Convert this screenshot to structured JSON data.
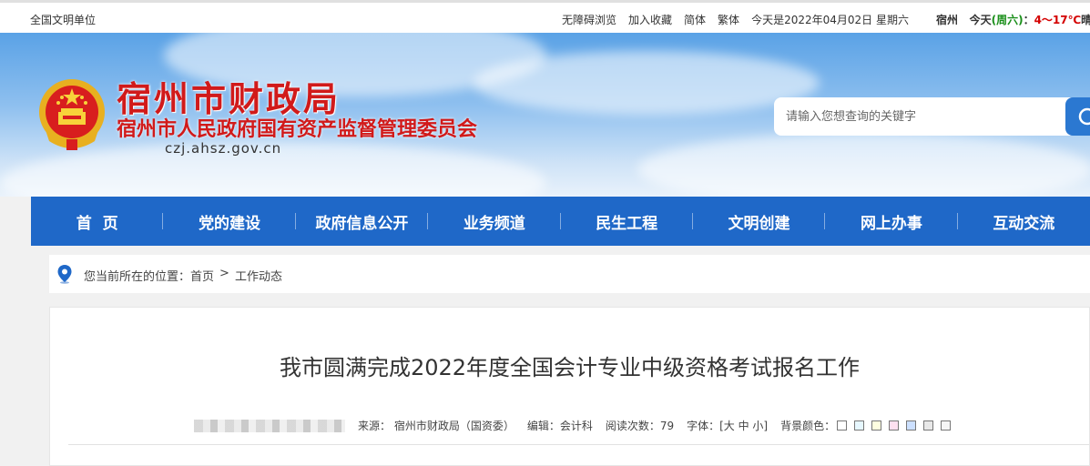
{
  "topbar": {
    "unit": "全国文明单位",
    "links": [
      "无障碍浏览",
      "加入收藏",
      "简体",
      "繁体",
      "今天是2022年04月02日 星期六"
    ],
    "weather_city": "宿州",
    "weather_today": "今天",
    "weather_day": "(周六)",
    "weather_colon": "：",
    "weather_temp": "4～17℃",
    "weather_trail": "晴"
  },
  "header": {
    "title": "宿州市财政局",
    "subtitle": "宿州市人民政府国有资产监督管理委员会",
    "domain": "czj.ahsz.gov.cn",
    "search_placeholder": "请输入您想查询的关键字"
  },
  "nav": {
    "items": [
      "首  页",
      "党的建设",
      "政府信息公开",
      "业务频道",
      "民生工程",
      "文明创建",
      "网上办事",
      "互动交流"
    ]
  },
  "breadcrumb": {
    "prefix": "您当前所在的位置：",
    "home": "首页",
    "sep": ">",
    "current": "工作动态"
  },
  "article": {
    "title": "我市圆满完成2022年度全国会计专业中级资格考试报名工作",
    "source": "来源： 宿州市财政局（国资委）",
    "editor": "编辑：会计科",
    "reads": "阅读次数：79",
    "font": "字体：[大 中 小]",
    "bg_label": "背景颜色：",
    "bg_colors": [
      "#ffffff",
      "#e6f7ff",
      "#ffffe0",
      "#ffe0f0",
      "#cce0ff",
      "#e8e8e8",
      "#f5f5f5"
    ]
  }
}
